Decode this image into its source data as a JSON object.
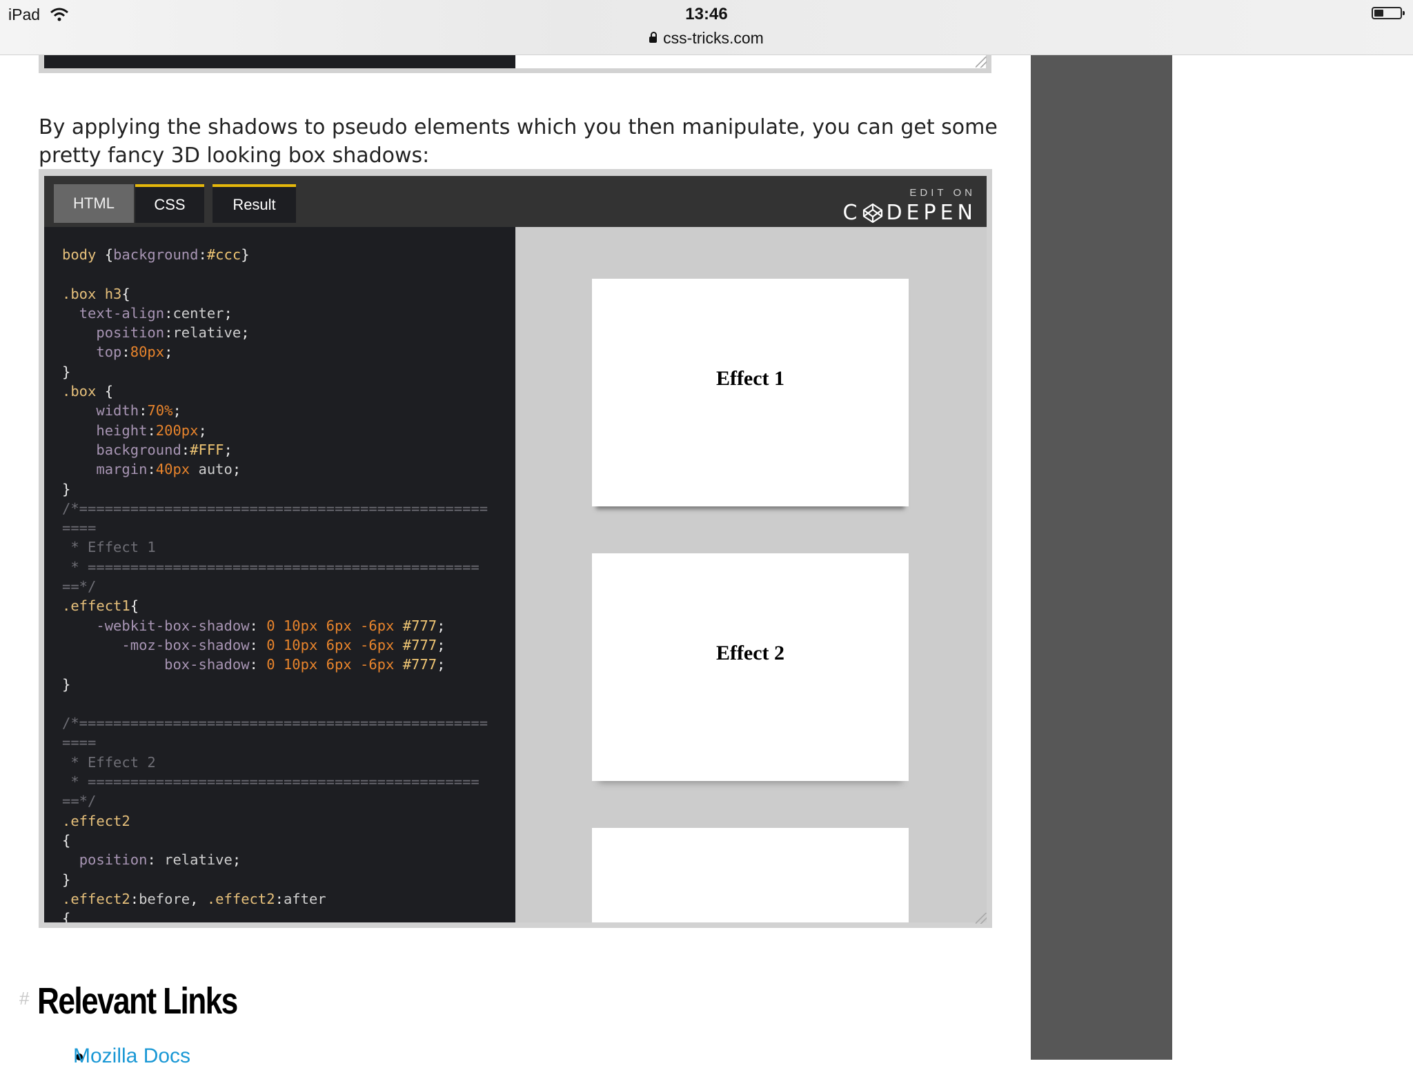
{
  "status_bar": {
    "device": "iPad",
    "time": "13:46",
    "url": "css-tricks.com"
  },
  "article": {
    "intro": "By applying the shadows to pseudo elements which you then manipulate, you can get some pretty fancy 3D looking box shadows:",
    "section_title": "Relevant Links",
    "section_hash": "#",
    "links": [
      "Mozilla Docs"
    ]
  },
  "embed": {
    "tabs": [
      "HTML",
      "CSS",
      "Result"
    ],
    "active_tab": "CSS",
    "edit_on": "EDIT ON",
    "brand": "DEPEN",
    "brand_prefix": "C",
    "code_language": "css",
    "code_lines": [
      "body {background:#ccc}",
      "",
      ".box h3{",
      "  text-align:center;",
      "    position:relative;",
      "    top:80px;",
      "}",
      ".box {",
      "    width:70%;",
      "    height:200px;",
      "    background:#FFF;",
      "    margin:40px auto;",
      "}",
      "/*================================================",
      "====",
      " * Effect 1",
      " * ==============================================",
      "==*/",
      ".effect1{",
      "    -webkit-box-shadow: 0 10px 6px -6px #777;",
      "       -moz-box-shadow: 0 10px 6px -6px #777;",
      "            box-shadow: 0 10px 6px -6px #777;",
      "}",
      "",
      "/*================================================",
      "====",
      " * Effect 2",
      " * ==============================================",
      "==*/",
      ".effect2",
      "{",
      "  position: relative;",
      "}",
      ".effect2:before, .effect2:after",
      "{"
    ],
    "result_boxes": [
      {
        "label": "Effect 1"
      },
      {
        "label": "Effect 2"
      },
      {
        "label": ""
      }
    ]
  }
}
